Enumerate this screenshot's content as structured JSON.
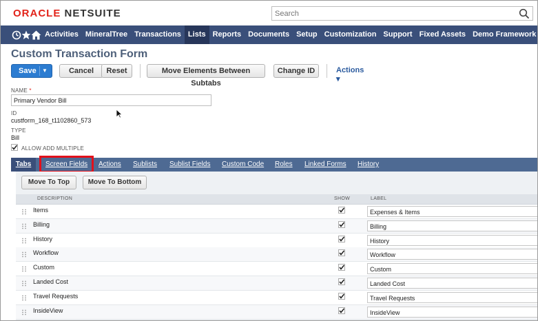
{
  "header": {
    "logo_oracle": "ORACLE",
    "logo_netsuite": "NETSUITE",
    "search_placeholder": "Search"
  },
  "nav": {
    "icons": [
      "recent-icon",
      "star-icon",
      "home-icon"
    ],
    "items": [
      {
        "label": "Activities",
        "active": false
      },
      {
        "label": "MineralTree",
        "active": false
      },
      {
        "label": "Transactions",
        "active": false
      },
      {
        "label": "Lists",
        "active": true
      },
      {
        "label": "Reports",
        "active": false
      },
      {
        "label": "Documents",
        "active": false
      },
      {
        "label": "Setup",
        "active": false
      },
      {
        "label": "Customization",
        "active": false
      },
      {
        "label": "Support",
        "active": false
      },
      {
        "label": "Fixed Assets",
        "active": false
      },
      {
        "label": "Demo Framework",
        "active": false
      }
    ]
  },
  "page": {
    "title": "Custom Transaction Form"
  },
  "toolbar": {
    "save": "Save",
    "cancel": "Cancel",
    "reset": "Reset",
    "move_elements": "Move Elements Between Subtabs",
    "change_id": "Change ID",
    "actions": "Actions ▾"
  },
  "form": {
    "name_label": "NAME",
    "required_mark": "*",
    "name_value": "Primary Vendor Bill",
    "id_label": "ID",
    "id_value": "custform_168_t1102860_573",
    "type_label": "TYPE",
    "type_value": "Bill",
    "allow_add_multiple": "ALLOW ADD MULTIPLE"
  },
  "subtabs": {
    "tabs": "Tabs",
    "screen_fields": "Screen Fields",
    "actions": "Actions",
    "sublists": "Sublists",
    "sublist_fields": "Sublist Fields",
    "custom_code": "Custom Code",
    "roles": "Roles",
    "linked_forms": "Linked Forms",
    "history": "History"
  },
  "panel": {
    "move_to_top": "Move To Top",
    "move_to_bottom": "Move To Bottom",
    "col_description": "DESCRIPTION",
    "col_show": "SHOW",
    "col_label": "LABEL",
    "rows": [
      {
        "description": "Items",
        "label": "Expenses & Items"
      },
      {
        "description": "Billing",
        "label": "Billing"
      },
      {
        "description": "History",
        "label": "History"
      },
      {
        "description": "Workflow",
        "label": "Workflow"
      },
      {
        "description": "Custom",
        "label": "Custom"
      },
      {
        "description": "Landed Cost",
        "label": "Landed Cost"
      },
      {
        "description": "Travel Requests",
        "label": "Travel Requests"
      },
      {
        "description": "InsideView",
        "label": "InsideView"
      }
    ]
  },
  "colors": {
    "nav_bg": "#3a4f7a",
    "subtab_bg": "#4e6a93",
    "save_blue": "#2c7cd1",
    "highlight_red": "#e2101b",
    "oracle_red": "#e2231a"
  }
}
